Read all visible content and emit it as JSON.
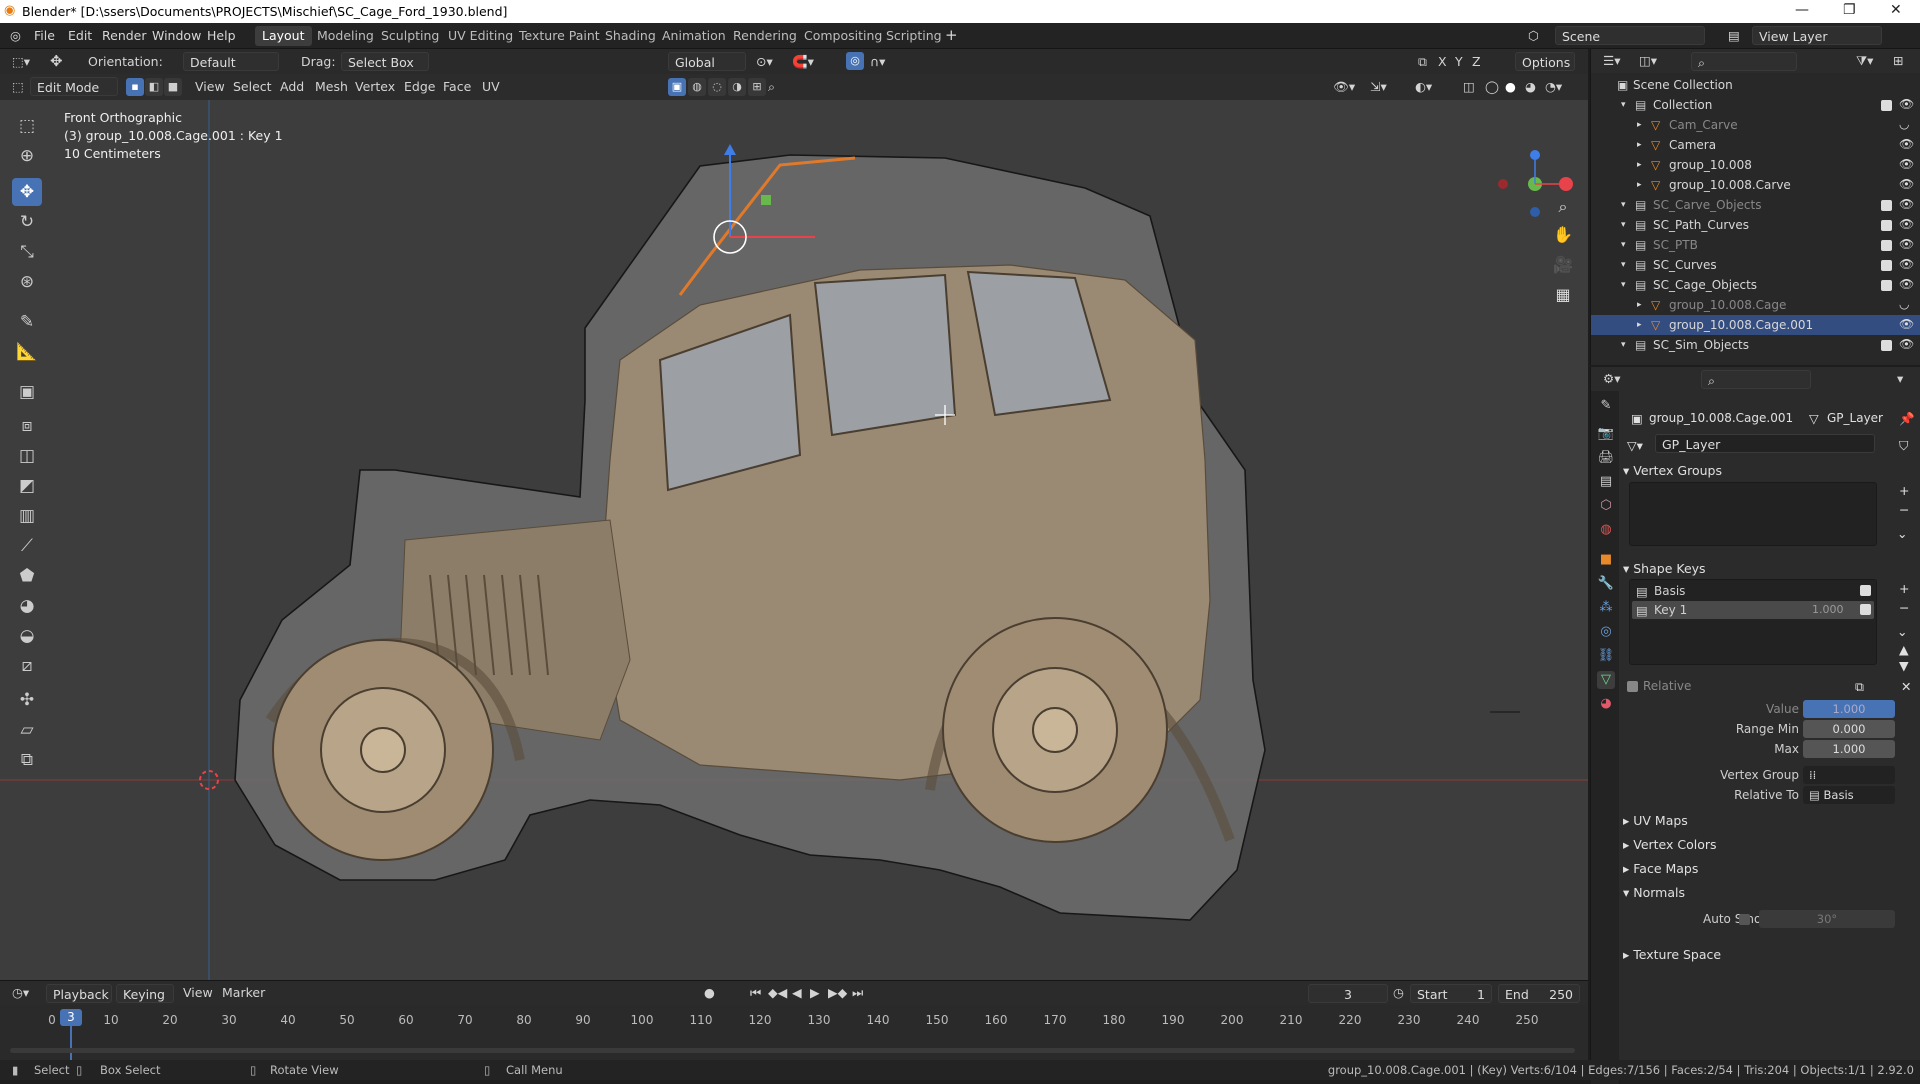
{
  "window": {
    "title": "Blender* [D:\\ssers\\Documents\\PROJECTS\\Mischief\\SC_Cage_Ford_1930.blend]"
  },
  "menu": {
    "file": "File",
    "edit": "Edit",
    "render": "Render",
    "window": "Window",
    "help": "Help"
  },
  "workspaces": [
    "Layout",
    "Modeling",
    "Sculpting",
    "UV Editing",
    "Texture Paint",
    "Shading",
    "Animation",
    "Rendering",
    "Compositing",
    "Scripting"
  ],
  "scene": {
    "name": "Scene",
    "view_layer": "View Layer"
  },
  "header": {
    "orientation_label": "Orientation:",
    "orientation_value": "Default",
    "drag_label": "Drag:",
    "drag_value": "Select Box",
    "transform_orientation": "Global",
    "options": "Options",
    "axes": [
      "X",
      "Y",
      "Z"
    ]
  },
  "mode_header": {
    "mode": "Edit Mode",
    "view": "View",
    "select": "Select",
    "add": "Add",
    "mesh": "Mesh",
    "vertex": "Vertex",
    "edge": "Edge",
    "face": "Face",
    "uv": "UV"
  },
  "viewport": {
    "view_name": "Front Orthographic",
    "object_info": "(3) group_10.008.Cage.001 : Key 1",
    "scale": "10 Centimeters"
  },
  "outliner": {
    "root": "Scene Collection",
    "items": [
      {
        "label": "Collection",
        "indent": 1,
        "checked": true,
        "visible": true,
        "dim": false
      },
      {
        "label": "Cam_Carve",
        "indent": 2,
        "checked": false,
        "visible": false,
        "dim": true
      },
      {
        "label": "Camera",
        "indent": 2,
        "checked": false,
        "visible": true,
        "dim": false
      },
      {
        "label": "group_10.008",
        "indent": 2,
        "checked": false,
        "visible": true,
        "dim": false
      },
      {
        "label": "group_10.008.Carve",
        "indent": 2,
        "checked": false,
        "visible": true,
        "dim": false
      },
      {
        "label": "SC_Carve_Objects",
        "indent": 1,
        "checked": true,
        "visible": true,
        "dim": true
      },
      {
        "label": "SC_Path_Curves",
        "indent": 1,
        "checked": true,
        "visible": true,
        "dim": false
      },
      {
        "label": "SC_PTB",
        "indent": 1,
        "checked": true,
        "visible": true,
        "dim": true
      },
      {
        "label": "SC_Curves",
        "indent": 1,
        "checked": true,
        "visible": true,
        "dim": false
      },
      {
        "label": "SC_Cage_Objects",
        "indent": 1,
        "checked": true,
        "visible": true,
        "dim": false
      },
      {
        "label": "group_10.008.Cage",
        "indent": 2,
        "checked": false,
        "visible": false,
        "dim": true
      },
      {
        "label": "group_10.008.Cage.001",
        "indent": 2,
        "checked": false,
        "visible": true,
        "dim": false,
        "selected": true
      },
      {
        "label": "SC_Sim_Objects",
        "indent": 1,
        "checked": true,
        "visible": true,
        "dim": false
      }
    ]
  },
  "properties": {
    "object": "group_10.008.Cage.001",
    "data_name": "GP_Layer",
    "mesh_name": "GP_Layer",
    "vertex_groups": "Vertex Groups",
    "shape_keys": "Shape Keys",
    "keys": [
      {
        "name": "Basis",
        "value": ""
      },
      {
        "name": "Key 1",
        "value": "1.000"
      }
    ],
    "relative": "Relative",
    "value_label": "Value",
    "value": "1.000",
    "range_min_label": "Range Min",
    "range_min": "0.000",
    "max_label": "Max",
    "max": "1.000",
    "vertex_group_label": "Vertex Group",
    "relative_to_label": "Relative To",
    "relative_to": "Basis",
    "uv_maps": "UV Maps",
    "vertex_colors": "Vertex Colors",
    "face_maps": "Face Maps",
    "normals": "Normals",
    "auto_smooth": "Auto Smooth",
    "auto_smooth_angle": "30°",
    "texture_space": "Texture Space"
  },
  "timeline": {
    "playback": "Playback",
    "keying": "Keying",
    "view": "View",
    "marker": "Marker",
    "current_frame": "3",
    "start_label": "Start",
    "start": "1",
    "end_label": "End",
    "end": "250",
    "ticks": [
      "0",
      "10",
      "20",
      "30",
      "40",
      "50",
      "60",
      "70",
      "80",
      "90",
      "100",
      "110",
      "120",
      "130",
      "140",
      "150",
      "160",
      "170",
      "180",
      "190",
      "200",
      "210",
      "220",
      "230",
      "240",
      "250"
    ]
  },
  "status": {
    "select": "Select",
    "box_select": "Box Select",
    "rotate_view": "Rotate View",
    "call_menu": "Call Menu",
    "stats": "group_10.008.Cage.001 | (Key) Verts:6/104 | Edges:7/156 | Faces:2/54 | Tris:204 | Objects:1/1 | 2.92.0"
  }
}
